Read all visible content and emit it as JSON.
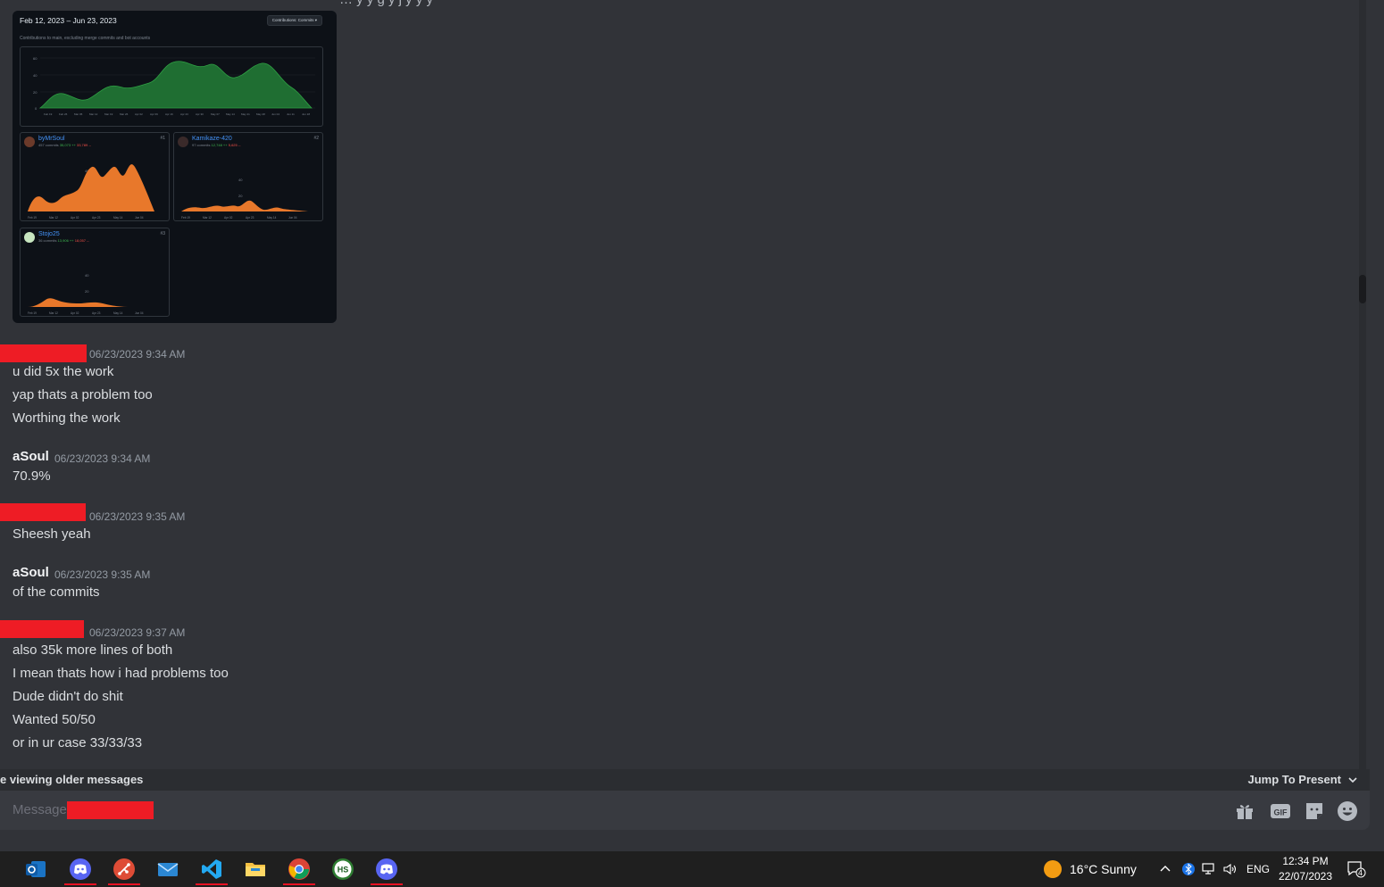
{
  "top_cut_text": "… y                                                     y                                    g                    y  j    y    y                                      y",
  "embed": {
    "date_range": "Feb 12, 2023 – Jun 23, 2023",
    "contrib_button": "Contributions: Commits ▾",
    "subtitle": "Contributions to main, excluding merge commits and bot accounts",
    "main_y_ticks": [
      "60",
      "40",
      "20",
      "0"
    ],
    "main_x_ticks": [
      "Feb 19",
      "Feb 26",
      "Mar 05",
      "Mar 12",
      "Mar 19",
      "Mar 26",
      "Apr 02",
      "Apr 09",
      "Apr 16",
      "Apr 23",
      "Apr 30",
      "May 07",
      "May 14",
      "May 21",
      "May 28",
      "Jun 04",
      "Jun 11",
      "Jun 18"
    ],
    "card_x_ticks": [
      "Feb 19",
      "Mar 12",
      "Apr 02",
      "Apr 23",
      "May 14",
      "Jun 04"
    ],
    "contributors": [
      {
        "name": "byMrSoul",
        "commits": "457 commits",
        "additions": "35,073 ++",
        "deletions": "33,789 --",
        "rank": "#1"
      },
      {
        "name": "Kamikaze-420",
        "commits": "97 commits",
        "additions": "12,748 ++",
        "deletions": "5,625 --",
        "rank": "#2"
      },
      {
        "name": "Stojo25",
        "commits": "36 commits",
        "additions": "13,906 ++",
        "deletions": "18,057 --",
        "rank": "#3"
      }
    ],
    "card_y_ticks": [
      "40",
      "20"
    ]
  },
  "messages": [
    {
      "author": "",
      "timestamp": "06/23/2023 9:34 AM",
      "lines": [
        "u did 5x the work",
        "yap thats a problem too",
        "Worthing the work"
      ]
    },
    {
      "author": "aSoul",
      "timestamp": "06/23/2023 9:34 AM",
      "lines": [
        "70.9%"
      ]
    },
    {
      "author": "",
      "timestamp": "06/23/2023 9:35 AM",
      "lines": [
        "Sheesh yeah"
      ]
    },
    {
      "author": "aSoul",
      "timestamp": "06/23/2023 9:35 AM",
      "lines": [
        "of the commits"
      ]
    },
    {
      "author": "",
      "timestamp": "06/23/2023 9:37 AM",
      "lines": [
        "also 35k more lines of both",
        "I mean thats how i had problems too",
        "Dude didn't do shit",
        "Wanted 50/50",
        "or in ur case 33/33/33"
      ]
    }
  ],
  "older_bar": {
    "text": "e viewing older messages",
    "jump_label": "Jump To Present"
  },
  "composer": {
    "placeholder": "Message",
    "gif_label": "GIF"
  },
  "taskbar": {
    "apps": [
      "outlook-icon",
      "discord-icon",
      "git-icon",
      "mail-icon",
      "vscode-icon",
      "file-explorer-icon",
      "chrome-icon",
      "hs-icon",
      "discord-icon-2"
    ],
    "hs_label": "HS",
    "weather": "16°C  Sunny",
    "language": "ENG",
    "time": "12:34 PM",
    "date": "22/07/2023",
    "notification_count": "4"
  }
}
